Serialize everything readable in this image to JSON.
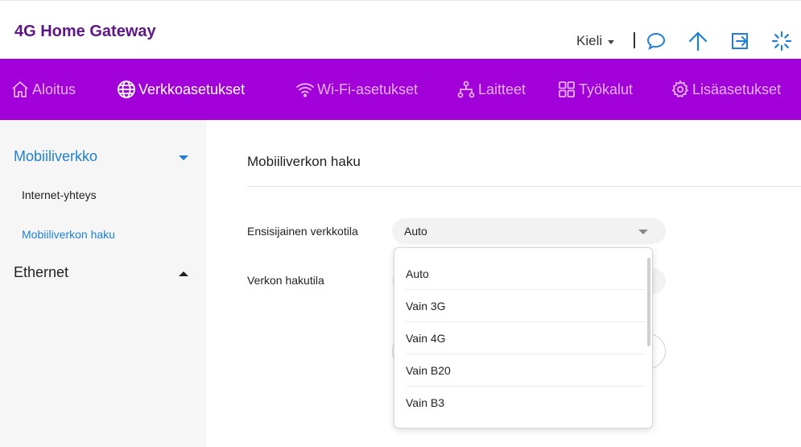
{
  "header": {
    "brand": "4G Home Gateway",
    "language_label": "Kieli",
    "icons": [
      "chat-icon",
      "upload-arrow-icon",
      "logout-icon",
      "loading-spinner-icon"
    ],
    "icon_color": "#1e7fd6"
  },
  "nav": {
    "background": "#a100d8",
    "items": [
      {
        "label": "Aloitus",
        "icon": "home-icon"
      },
      {
        "label": "Verkkoasetukset",
        "icon": "globe-icon"
      },
      {
        "label": "Wi-Fi-asetukset",
        "icon": "wifi-icon"
      },
      {
        "label": "Laitteet",
        "icon": "devices-icon"
      },
      {
        "label": "Työkalut",
        "icon": "tools-grid-icon"
      },
      {
        "label": "Lisäasetukset",
        "icon": "gear-icon"
      }
    ],
    "active": "Verkkoasetukset"
  },
  "sidebar": {
    "groups": [
      {
        "label": "Mobiiliverkko",
        "expanded": true,
        "items": [
          {
            "label": "Internet-yhteys"
          },
          {
            "label": "Mobiiliverkon haku"
          }
        ]
      },
      {
        "label": "Ethernet",
        "expanded": false
      }
    ]
  },
  "main": {
    "title": "Mobiiliverkon haku",
    "fields": [
      {
        "label": "Ensisijainen verkkotila",
        "value": "Auto"
      },
      {
        "label": "Verkon hakutila"
      }
    ],
    "dropdown": {
      "options": [
        "Auto",
        "Vain 3G",
        "Vain 4G",
        "Vain B20",
        "Vain B3"
      ]
    }
  }
}
